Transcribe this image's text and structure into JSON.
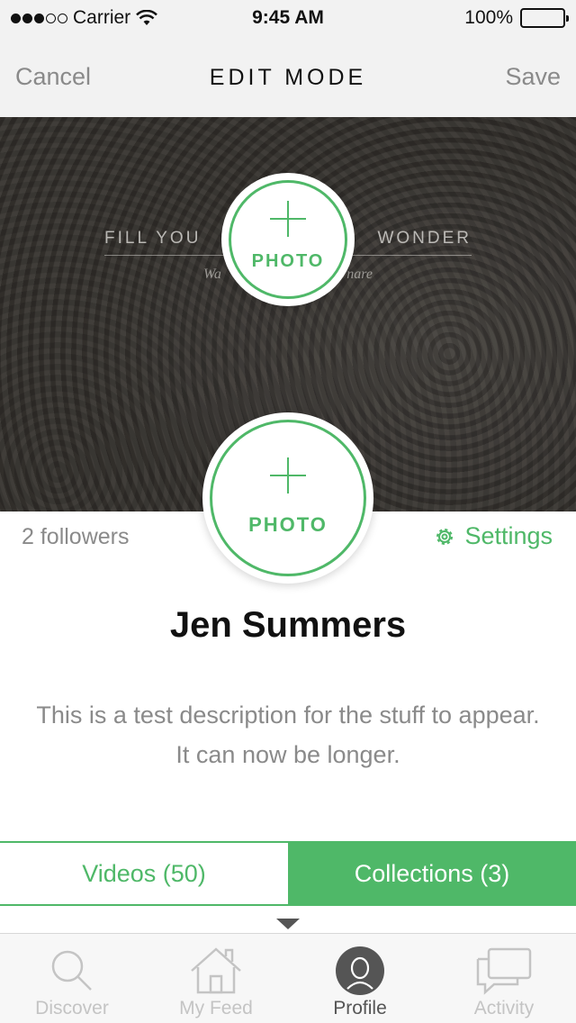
{
  "status_bar": {
    "carrier": "Carrier",
    "time": "9:45 AM",
    "battery": "100%",
    "battery_level": 1.0
  },
  "nav": {
    "cancel": "Cancel",
    "title": "EDIT MODE",
    "save": "Save"
  },
  "cover": {
    "headline_left": "FILL YOU",
    "headline_right": "WONDER",
    "subtitle_left": "Wa",
    "subtitle_right": "nare",
    "photo_label": "PHOTO"
  },
  "avatar": {
    "photo_label": "PHOTO"
  },
  "profile": {
    "followers": "2 followers",
    "settings": "Settings",
    "name": "Jen Summers",
    "description": "This is a test description for the stuff to appear. It can now be longer."
  },
  "tabs": {
    "videos": "Videos (50)",
    "collections": "Collections (3)"
  },
  "tab_bar": {
    "items": [
      {
        "label": "Discover",
        "icon": "search-icon"
      },
      {
        "label": "My Feed",
        "icon": "home-icon"
      },
      {
        "label": "Profile",
        "icon": "profile-icon"
      },
      {
        "label": "Activity",
        "icon": "chat-icon"
      }
    ]
  },
  "colors": {
    "accent": "#4fb868",
    "nav_background": "#f2f2f2",
    "muted_text": "#8a8a8a"
  }
}
